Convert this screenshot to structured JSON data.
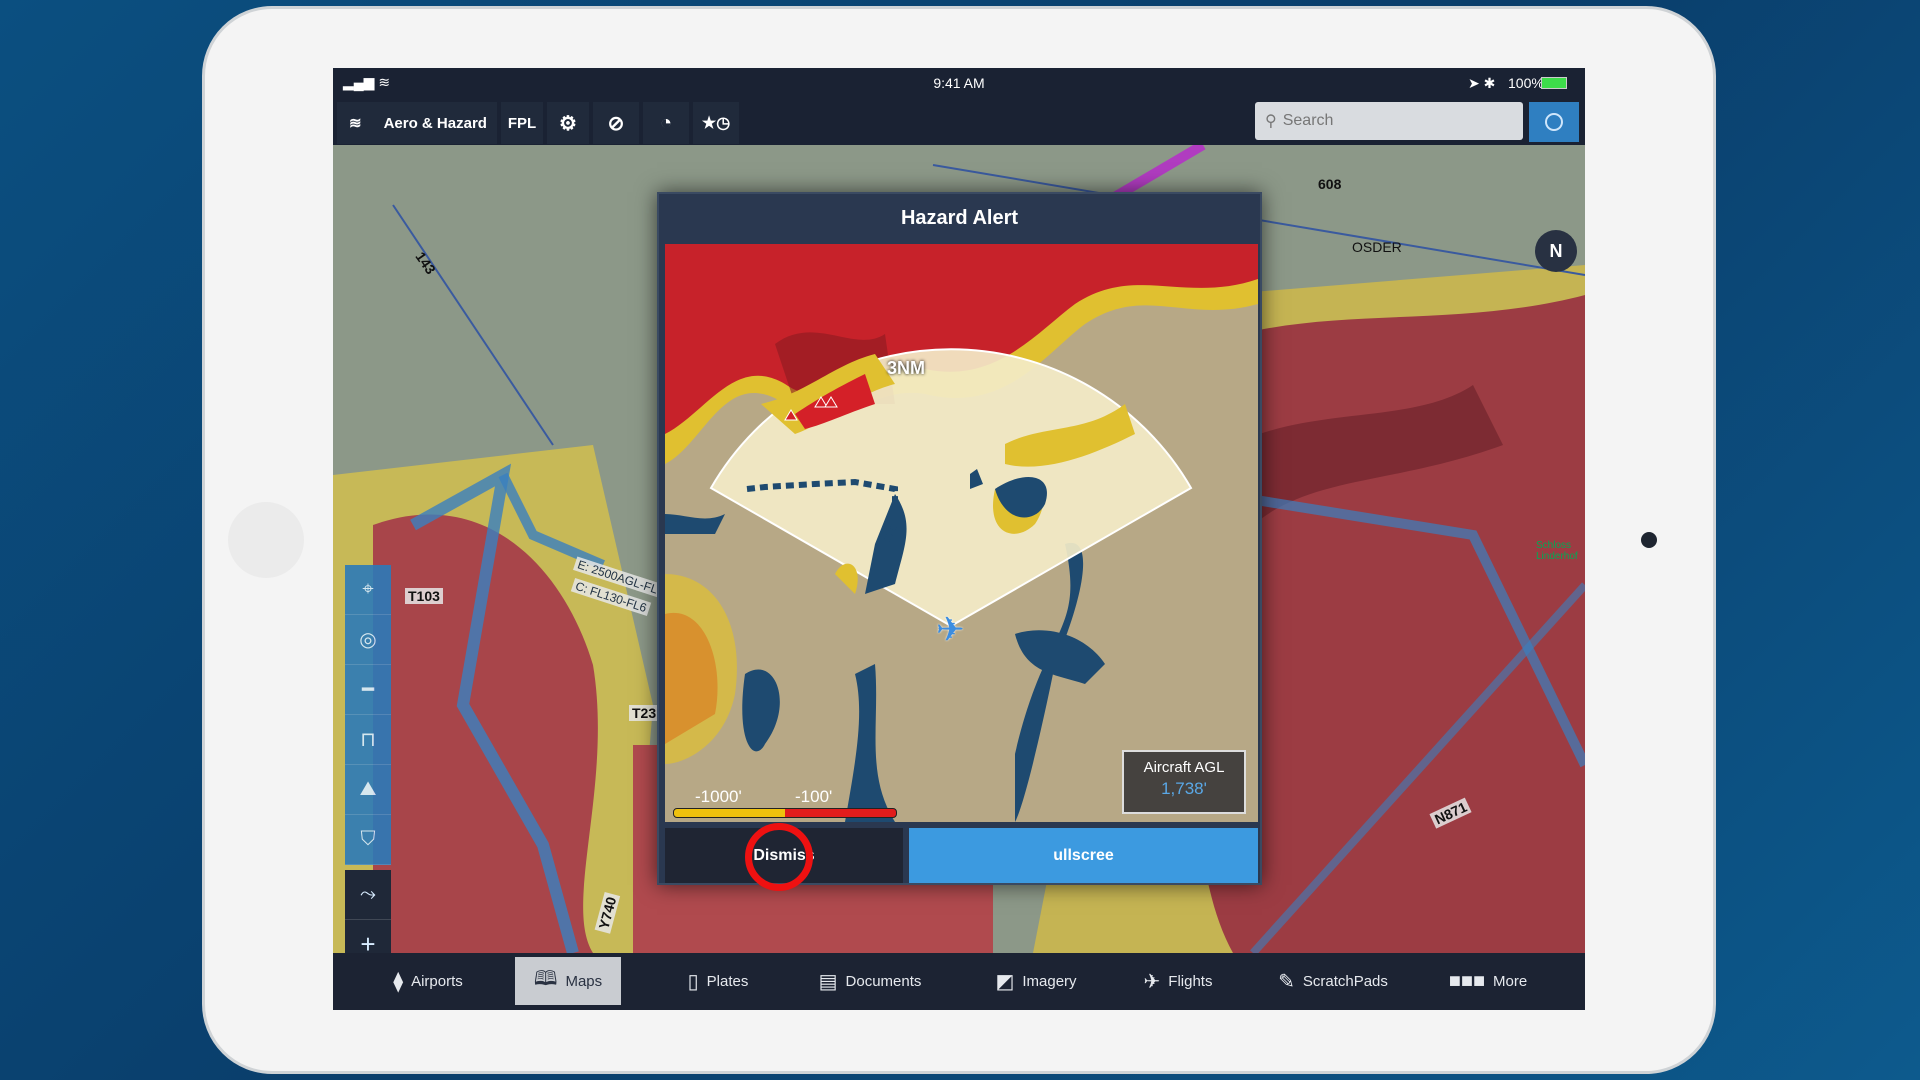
{
  "status": {
    "time": "9:41 AM",
    "battery": "100%"
  },
  "toolbar": {
    "layer_label": "Aero & Hazard",
    "fpl": "FPL",
    "search_placeholder": "Search"
  },
  "map_labels": {
    "airway_143": "143",
    "t103": "T103",
    "airspace_e": "E: 2500AGL-FL",
    "airspace_c": "C: FL130-FL6",
    "t23": "T23",
    "y740": "Y740",
    "osder": "OSDER",
    "n608": "608",
    "n871": "N871",
    "schloss": "Schloss Linderhof",
    "compass": "N"
  },
  "modal": {
    "title": "Hazard Alert",
    "range": "3NM",
    "legend_low": "-1000'",
    "legend_high": "-100'",
    "agl_label": "Aircraft AGL",
    "agl_value": "1,738'",
    "dismiss": "Dismiss",
    "fullscreen": "ullscree"
  },
  "bottom_tabs": [
    {
      "label": "Airports",
      "icon": "airport-icon"
    },
    {
      "label": "Maps",
      "icon": "map-icon",
      "active": true
    },
    {
      "label": "Plates",
      "icon": "plates-icon"
    },
    {
      "label": "Documents",
      "icon": "documents-icon"
    },
    {
      "label": "Imagery",
      "icon": "imagery-icon"
    },
    {
      "label": "Flights",
      "icon": "flights-icon"
    },
    {
      "label": "ScratchPads",
      "icon": "pencil-icon"
    },
    {
      "label": "More",
      "icon": "more-icon"
    }
  ],
  "colors": {
    "accent": "#3c9ae0",
    "hazard_red": "#d4202a",
    "hazard_yellow": "#e8c21a",
    "highlight_circle": "#ee1111"
  }
}
